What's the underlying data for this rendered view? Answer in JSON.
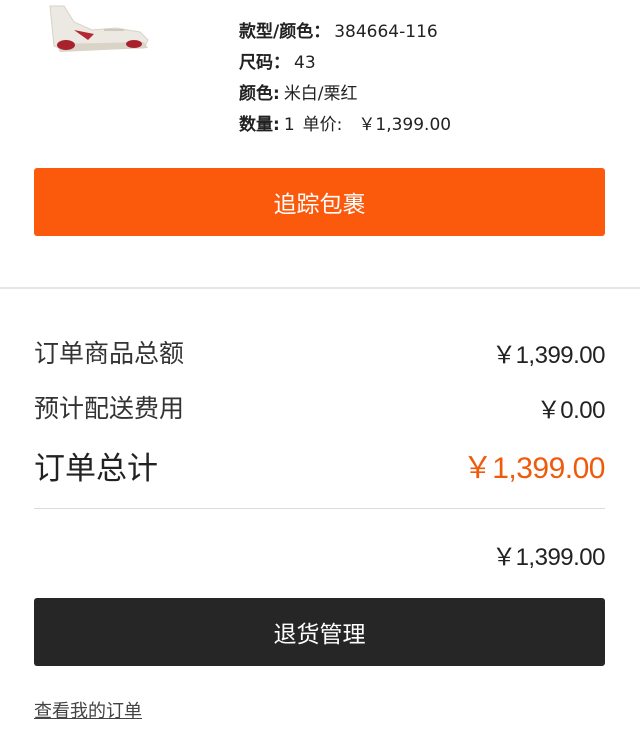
{
  "product": {
    "style_label": "款型/颜色：",
    "style_value": "384664-116",
    "size_label": "尺码：",
    "size_value": "43",
    "color_label": "颜色:",
    "color_value": "米白/栗红",
    "qty_label": "数量:",
    "qty_value": "1",
    "unit_price_label": "单价:",
    "unit_price_value": "￥1,399.00"
  },
  "actions": {
    "track_label": "追踪包裹",
    "return_label": "退货管理",
    "orders_link": "查看我的订单"
  },
  "summary": {
    "subtotal_label": "订单商品总额",
    "subtotal_value": "￥1,399.00",
    "shipping_label": "预计配送费用",
    "shipping_value": "￥0.00",
    "total_label": "订单总计",
    "total_value": "￥1,399.00",
    "paid_value": "￥1,399.00"
  },
  "colors": {
    "accent": "#fb5a0c",
    "total_text": "#f05a0c",
    "dark_button": "#262626"
  },
  "icons": {
    "product_image": "sneaker-image"
  }
}
